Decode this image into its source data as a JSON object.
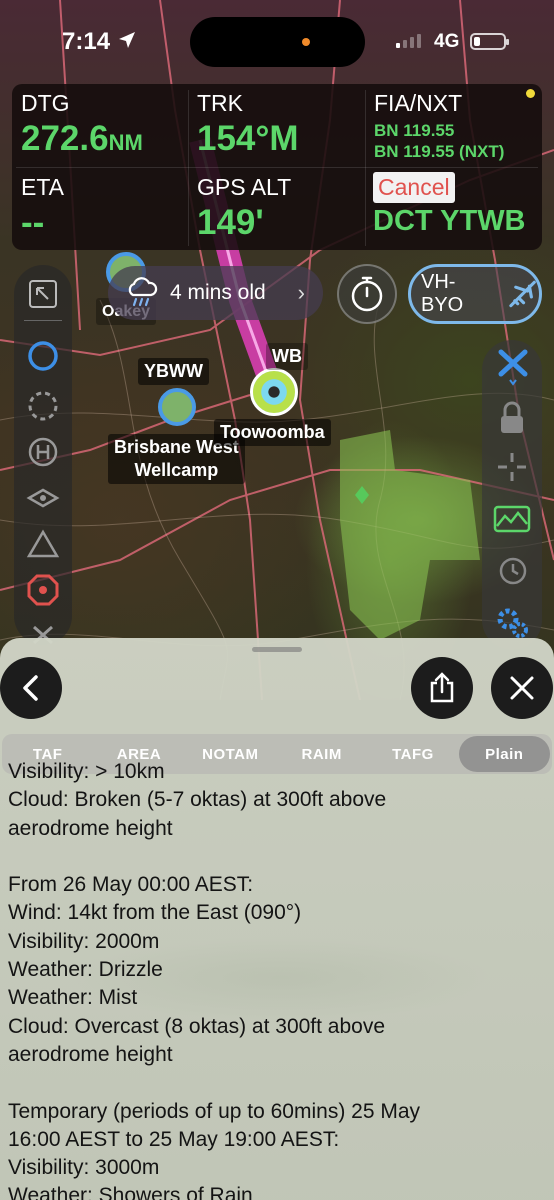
{
  "status_bar": {
    "time": "7:14",
    "network": "4G"
  },
  "panel": {
    "dtg": {
      "label": "DTG",
      "value": "272.6",
      "unit": "NM"
    },
    "trk": {
      "label": "TRK",
      "value": "154°M"
    },
    "fia": {
      "label": "FIA/NXT",
      "freq1": "BN  119.55",
      "freq2": "BN  119.55 (NXT)"
    },
    "eta": {
      "label": "ETA",
      "value": "--"
    },
    "gps_alt": {
      "label": "GPS ALT",
      "value": "149'"
    },
    "cancel_label": "Cancel",
    "direct": "DCT YTWB"
  },
  "map": {
    "weather_pill": {
      "text": "4 mins old",
      "icon": "cloud-rain-icon"
    },
    "aircraft": "VH-BYO",
    "labels": {
      "ybww": "YBWW",
      "brisbane_west": "Brisbane West\nWellcamp",
      "toowoomba": "Toowoomba",
      "wb": "WB",
      "oakey": "Oakey"
    },
    "colors": {
      "route": "#e040b8",
      "accent": "#3d8fe6"
    }
  },
  "sheet": {
    "tabs": [
      "TAF",
      "AREA",
      "NOTAM",
      "RAIM",
      "TAFG",
      "Plain"
    ],
    "active_tab": "Plain",
    "paragraphs": [
      [
        "Visibility: > 10km",
        "Cloud: Broken (5-7 oktas) at 300ft above",
        "aerodrome height"
      ],
      [
        "From 26 May 00:00 AEST:",
        "Wind: 14kt from the East (090°)",
        "Visibility: 2000m",
        "Weather: Drizzle",
        "Weather: Mist",
        "Cloud: Overcast (8 oktas) at 300ft above",
        "aerodrome height"
      ],
      [
        "Temporary (periods of up to 60mins) 25 May",
        "16:00 AEST to 25 May 19:00 AEST:",
        "Visibility: 3000m",
        "Weather: Showers of Rain"
      ]
    ]
  }
}
